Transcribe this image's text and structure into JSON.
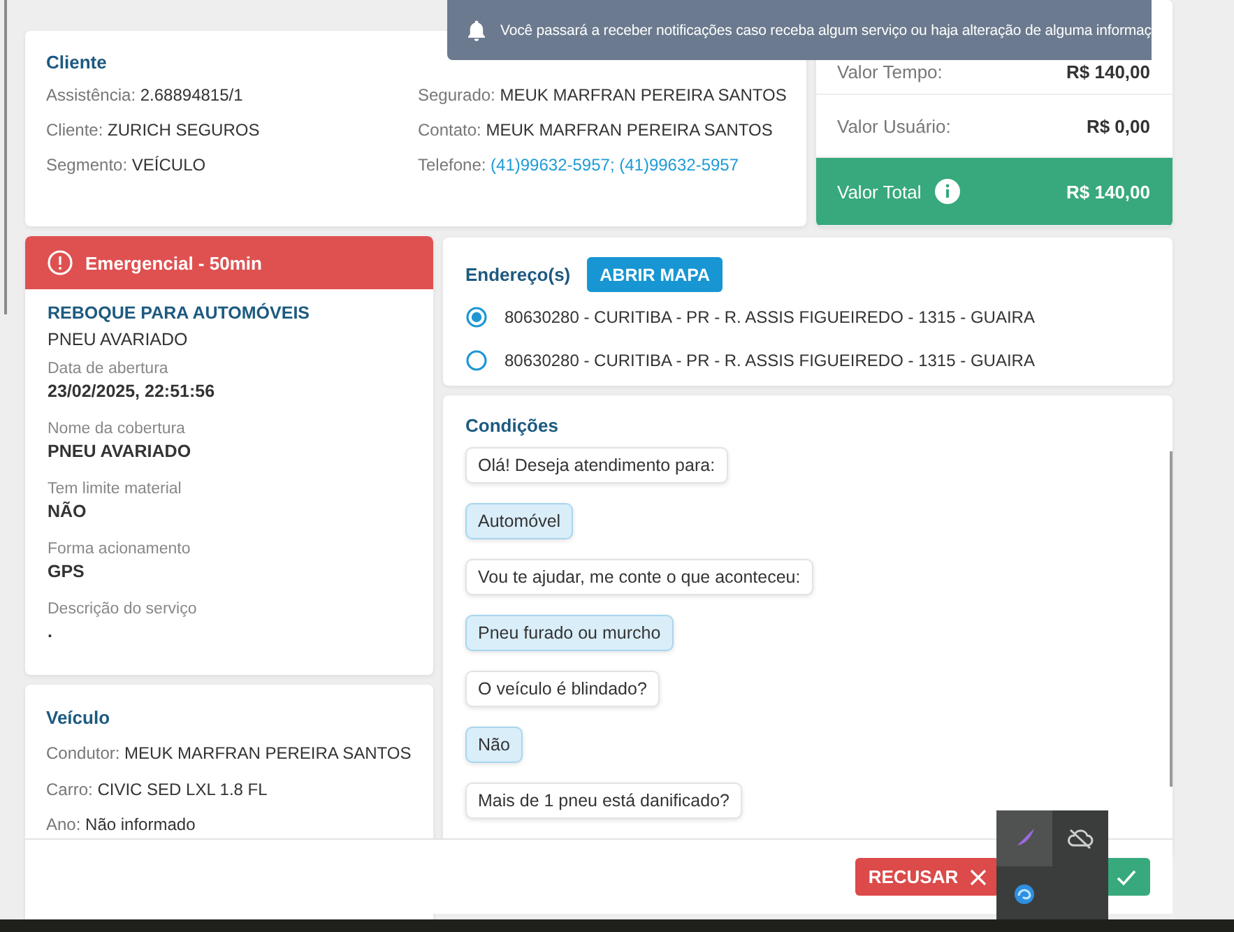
{
  "notification": {
    "text": "Você passará a receber notificações caso receba algum serviço ou haja alteração de alguma informaç"
  },
  "client": {
    "title": "Cliente",
    "fields": [
      {
        "label": "Assistência:",
        "value": "2.68894815/1",
        "kind": "text"
      },
      {
        "label": "Cliente:",
        "value": "ZURICH SEGUROS",
        "kind": "text"
      },
      {
        "label": "Segmento:",
        "value": "VEÍCULO",
        "kind": "text"
      },
      {
        "label": "Segurado:",
        "value": "MEUK MARFRAN PEREIRA SANTOS",
        "kind": "text"
      },
      {
        "label": "Contato:",
        "value": "MEUK MARFRAN PEREIRA SANTOS",
        "kind": "text"
      },
      {
        "label": "Telefone:",
        "value": "(41)99632-5957; (41)99632-5957",
        "kind": "link"
      }
    ]
  },
  "values": [
    {
      "label": "Valor Tempo:",
      "value": "R$ 140,00",
      "kind": "plain"
    },
    {
      "label": "Valor Usuário:",
      "value": "R$ 0,00",
      "kind": "plain"
    },
    {
      "label": "Valor Total",
      "value": "R$ 140,00",
      "kind": "total"
    }
  ],
  "service": {
    "priority": "Emergencial - 50min",
    "title": "REBOQUE PARA AUTOMÓVEIS",
    "subtitle": "PNEU AVARIADO",
    "details": [
      {
        "label": "Data de abertura",
        "value": "23/02/2025, 22:51:56"
      },
      {
        "label": "Nome da cobertura",
        "value": "PNEU AVARIADO"
      },
      {
        "label": "Tem limite material",
        "value": "NÃO"
      },
      {
        "label": "Forma acionamento",
        "value": "GPS"
      },
      {
        "label": "Descrição do serviço",
        "value": "."
      }
    ]
  },
  "vehicle": {
    "title": "Veículo",
    "fields": [
      {
        "label": "Condutor:",
        "value": "MEUK MARFRAN PEREIRA SANTOS"
      },
      {
        "label": "Carro:",
        "value": "CIVIC SED LXL 1.8 FL"
      },
      {
        "label": "Ano:",
        "value": "Não informado"
      }
    ]
  },
  "addresses": {
    "title": "Endereço(s)",
    "map_button": "ABRIR MAPA",
    "items": [
      {
        "text": "80630280 - CURITIBA - PR - R. ASSIS FIGUEIREDO - 1315 - GUAIRA",
        "selected": true
      },
      {
        "text": "80630280 - CURITIBA - PR - R. ASSIS FIGUEIREDO - 1315 - GUAIRA",
        "selected": false
      }
    ]
  },
  "conditions": {
    "title": "Condições",
    "messages": [
      {
        "kind": "question",
        "text": "Olá! Deseja atendimento para:"
      },
      {
        "kind": "answer",
        "text": "Automóvel"
      },
      {
        "kind": "question",
        "text": "Vou te ajudar, me conte o que aconteceu:"
      },
      {
        "kind": "answer",
        "text": "Pneu furado ou murcho"
      },
      {
        "kind": "question",
        "text": "O veículo é blindado?"
      },
      {
        "kind": "answer",
        "text": "Não"
      },
      {
        "kind": "question",
        "text": "Mais de 1 pneu está danificado?"
      }
    ]
  },
  "actions": {
    "reject": "RECUSAR"
  }
}
